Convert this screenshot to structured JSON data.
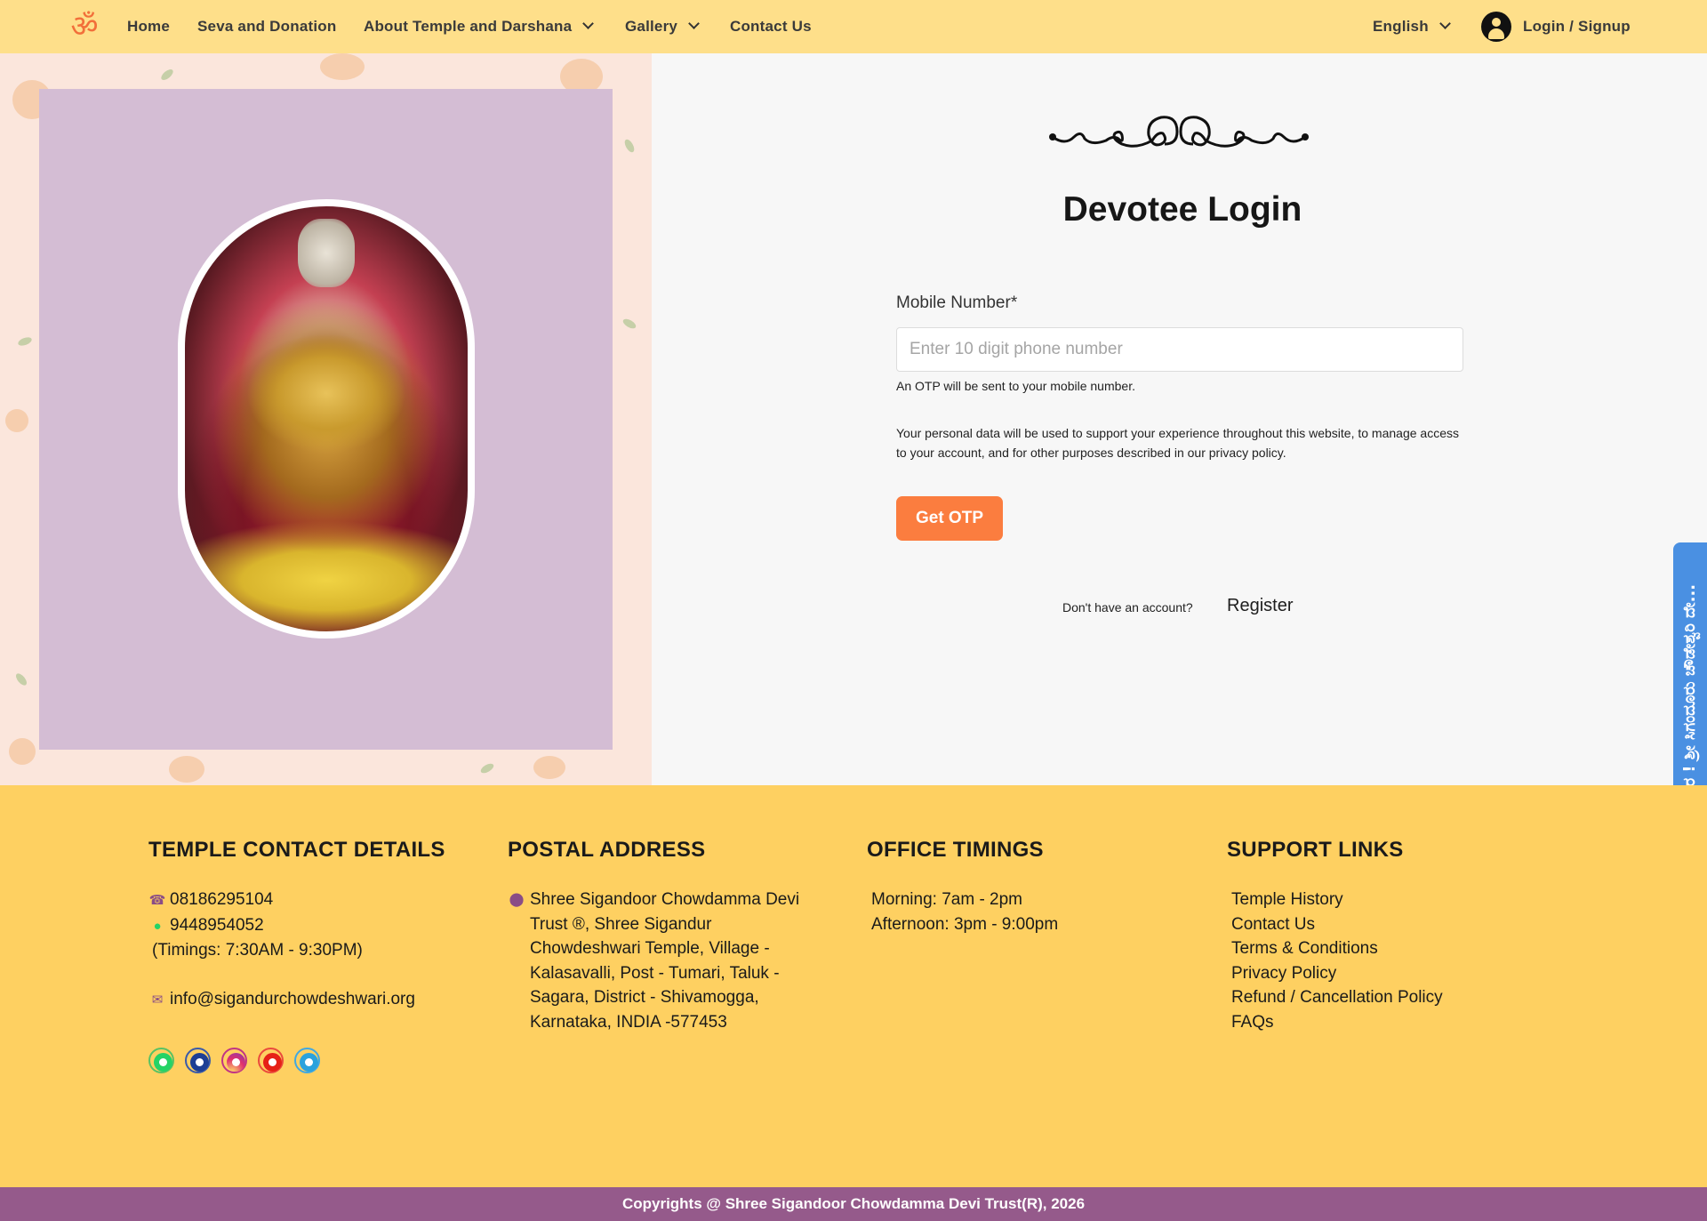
{
  "nav": {
    "logo_glyph": "ॐ",
    "items": [
      {
        "label": "Home"
      },
      {
        "label": "Seva and Donation"
      },
      {
        "label": "About Temple and Darshana"
      },
      {
        "label": "Gallery"
      },
      {
        "label": "Contact Us"
      }
    ],
    "language": "English",
    "login": "Login / Signup"
  },
  "login": {
    "title": "Devotee Login",
    "mobile_label": "Mobile Number*",
    "mobile_placeholder": "Enter 10 digit phone number",
    "mobile_value": "",
    "otp_note": "An OTP will be sent to your mobile number.",
    "privacy_text": "Your personal data will be used to support your experience throughout this website, to manage access to your account, and for other purposes described in our privacy policy.",
    "get_otp": "Get OTP",
    "no_account": "Don't have an account?",
    "register": "Register"
  },
  "side_tab": {
    "label": "ನಮಸ್ಕಾರ ! ಶ್ರೀ ಸಿಗಂದೂರು ಚೌಡೇಶ್ವರಿ ದೇ..."
  },
  "footer": {
    "contact": {
      "heading": "TEMPLE CONTACT DETAILS",
      "phone": "08186295104",
      "whatsapp": "9448954052",
      "timings": "(Timings: 7:30AM - 9:30PM)",
      "email": "info@sigandurchowdeshwari.org",
      "social": [
        "whatsapp-icon",
        "facebook-icon",
        "instagram-icon",
        "youtube-icon",
        "telegram-icon"
      ]
    },
    "postal": {
      "heading": "POSTAL ADDRESS",
      "lines": [
        "Shree Sigandoor Chowdamma Devi",
        "Trust ®, Shree Sigandur",
        "Chowdeshwari Temple, Village -",
        "Kalasavalli, Post - Tumari, Taluk -",
        "Sagara, District - Shivamogga,",
        "Karnataka, INDIA -577453"
      ]
    },
    "office": {
      "heading": "OFFICE TIMINGS",
      "morning": "Morning: 7am - 2pm",
      "afternoon": "Afternoon: 3pm - 9:00pm"
    },
    "support": {
      "heading": "SUPPORT LINKS",
      "links": [
        "Temple History",
        "Contact Us",
        "Terms & Conditions",
        "Privacy Policy",
        "Refund / Cancellation Policy",
        "FAQs"
      ]
    },
    "copyright": "Copyrights @ Shree Sigandoor Chowdamma Devi Trust(R), 2026"
  },
  "colors": {
    "nav_bg": "#fedf8a",
    "accent_orange": "#fb7d3f",
    "footer_bg": "#fed061",
    "copyright_bg": "#955a8b",
    "side_tab": "#4a90e2"
  }
}
